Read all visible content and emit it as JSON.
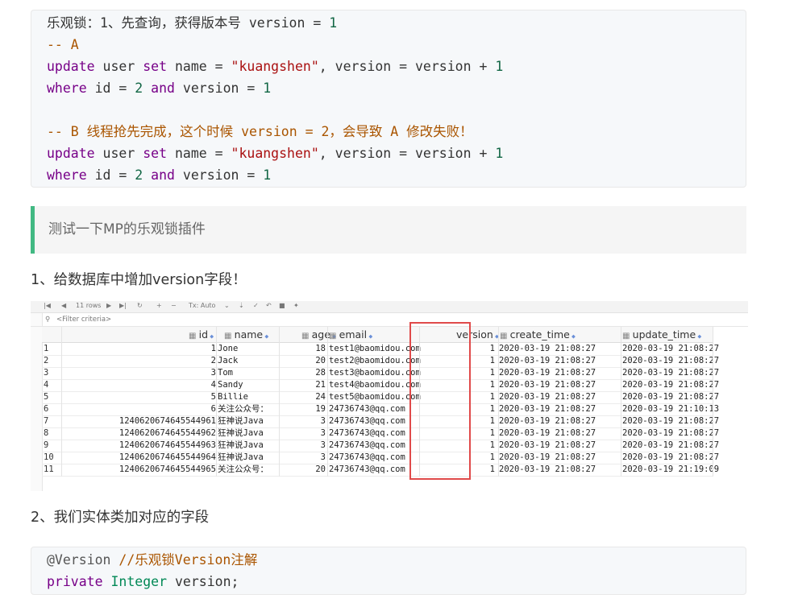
{
  "code1": {
    "lines": [
      [
        {
          "t": "乐观锁：1、先查询，获得版本号 version = ",
          "c": ""
        },
        {
          "t": "1",
          "c": "num"
        }
      ],
      [
        {
          "t": "-- A",
          "c": "cmt"
        }
      ],
      [
        {
          "t": "update",
          "c": "kw"
        },
        {
          "t": " user ",
          "c": ""
        },
        {
          "t": "set",
          "c": "kw"
        },
        {
          "t": " name = ",
          "c": ""
        },
        {
          "t": "\"kuangshen\"",
          "c": "str"
        },
        {
          "t": ", version = version + ",
          "c": ""
        },
        {
          "t": "1",
          "c": "num"
        }
      ],
      [
        {
          "t": "where",
          "c": "kw"
        },
        {
          "t": " id = ",
          "c": ""
        },
        {
          "t": "2",
          "c": "num"
        },
        {
          "t": " ",
          "c": ""
        },
        {
          "t": "and",
          "c": "kw"
        },
        {
          "t": " version = ",
          "c": ""
        },
        {
          "t": "1",
          "c": "num"
        }
      ],
      [
        {
          "t": "",
          "c": ""
        }
      ],
      [
        {
          "t": "-- B 线程抢先完成，这个时候 version = 2，会导致 A 修改失败！",
          "c": "cmt"
        }
      ],
      [
        {
          "t": "update",
          "c": "kw"
        },
        {
          "t": " user ",
          "c": ""
        },
        {
          "t": "set",
          "c": "kw"
        },
        {
          "t": " name = ",
          "c": ""
        },
        {
          "t": "\"kuangshen\"",
          "c": "str"
        },
        {
          "t": ", version = version + ",
          "c": ""
        },
        {
          "t": "1",
          "c": "num"
        }
      ],
      [
        {
          "t": "where",
          "c": "kw"
        },
        {
          "t": " id = ",
          "c": ""
        },
        {
          "t": "2",
          "c": "num"
        },
        {
          "t": " ",
          "c": ""
        },
        {
          "t": "and",
          "c": "kw"
        },
        {
          "t": " version = ",
          "c": ""
        },
        {
          "t": "1",
          "c": "num"
        }
      ]
    ]
  },
  "quote": "测试一下MP的乐观锁插件",
  "step1": "1、给数据库中增加version字段！",
  "step2": "2、我们实体类加对应的字段",
  "db": {
    "toolbar": {
      "rows": "11 rows",
      "tx": "Tx: Auto"
    },
    "filter_placeholder": "<Filter criteria>",
    "columns": [
      "id",
      "name",
      "age",
      "email",
      "version",
      "create_time",
      "update_time"
    ],
    "rows": [
      [
        "1",
        "1",
        "Jone",
        "18",
        "test1@baomidou.com",
        "1",
        "2020-03-19 21:08:27",
        "2020-03-19 21:08:27"
      ],
      [
        "2",
        "2",
        "Jack",
        "20",
        "test2@baomidou.com",
        "1",
        "2020-03-19 21:08:27",
        "2020-03-19 21:08:27"
      ],
      [
        "3",
        "3",
        "Tom",
        "28",
        "test3@baomidou.com",
        "1",
        "2020-03-19 21:08:27",
        "2020-03-19 21:08:27"
      ],
      [
        "4",
        "4",
        "Sandy",
        "21",
        "test4@baomidou.com",
        "1",
        "2020-03-19 21:08:27",
        "2020-03-19 21:08:27"
      ],
      [
        "5",
        "5",
        "Billie",
        "24",
        "test5@baomidou.com",
        "1",
        "2020-03-19 21:08:27",
        "2020-03-19 21:08:27"
      ],
      [
        "6",
        "6",
        "关注公众号：",
        "19",
        "24736743@qq.com",
        "1",
        "2020-03-19 21:08:27",
        "2020-03-19 21:10:13"
      ],
      [
        "7",
        "1240620674645544961",
        "狂神说Java",
        "3",
        "24736743@qq.com",
        "1",
        "2020-03-19 21:08:27",
        "2020-03-19 21:08:27"
      ],
      [
        "8",
        "1240620674645544962",
        "狂神说Java",
        "3",
        "24736743@qq.com",
        "1",
        "2020-03-19 21:08:27",
        "2020-03-19 21:08:27"
      ],
      [
        "9",
        "1240620674645544963",
        "狂神说Java",
        "3",
        "24736743@qq.com",
        "1",
        "2020-03-19 21:08:27",
        "2020-03-19 21:08:27"
      ],
      [
        "10",
        "1240620674645544964",
        "狂神说Java",
        "3",
        "24736743@qq.com",
        "1",
        "2020-03-19 21:08:27",
        "2020-03-19 21:08:27"
      ],
      [
        "11",
        "1240620674645544965",
        "关注公众号：",
        "20",
        "24736743@qq.com",
        "1",
        "2020-03-19 21:08:27",
        "2020-03-19 21:19:09"
      ]
    ],
    "highlight_color": "#e04a4a"
  },
  "code2": {
    "lines": [
      [
        {
          "t": "@Version",
          "c": "ann"
        },
        {
          "t": " ",
          "c": ""
        },
        {
          "t": "//乐观锁Version注解",
          "c": "cmt"
        }
      ],
      [
        {
          "t": "private",
          "c": "kw"
        },
        {
          "t": " ",
          "c": ""
        },
        {
          "t": "Integer",
          "c": "typ"
        },
        {
          "t": " version;",
          "c": ""
        }
      ]
    ]
  }
}
